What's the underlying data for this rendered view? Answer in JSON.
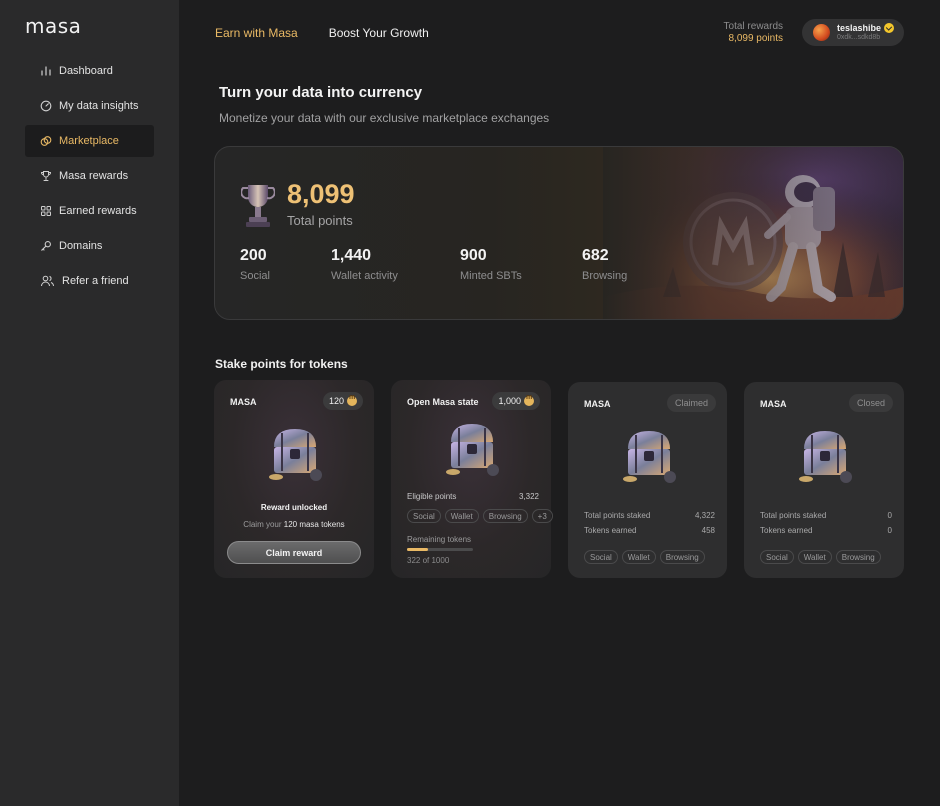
{
  "app": {
    "logo": "masa"
  },
  "sidebar": {
    "items": [
      {
        "label": "Dashboard",
        "icon": "bar-chart-icon"
      },
      {
        "label": "My data insights",
        "icon": "gauge-icon"
      },
      {
        "label": "Marketplace",
        "icon": "coins-icon",
        "active": true
      },
      {
        "label": "Masa rewards",
        "icon": "trophy-icon"
      },
      {
        "label": "Earned rewards",
        "icon": "grid-icon"
      },
      {
        "label": "Domains",
        "icon": "key-icon"
      },
      {
        "label": "Refer a friend",
        "icon": "users-icon"
      }
    ]
  },
  "topbar": {
    "tabs": [
      {
        "label": "Earn with Masa",
        "active": true
      },
      {
        "label": "Boost Your Growth",
        "active": false
      }
    ],
    "total_rewards_label": "Total rewards",
    "total_rewards_value": "8,099 points",
    "user": {
      "name": "teslashibe",
      "address": "0xdk...sdkd8b"
    }
  },
  "hero": {
    "title": "Turn your data into currency",
    "subtitle": "Monetize your data with our exclusive marketplace exchanges",
    "total_points": "8,099",
    "total_points_label": "Total points",
    "stats": [
      {
        "value": "200",
        "label": "Social"
      },
      {
        "value": "1,440",
        "label": "Wallet activity"
      },
      {
        "value": "900",
        "label": "Minted SBTs"
      },
      {
        "value": "682",
        "label": "Browsing"
      }
    ]
  },
  "stake": {
    "title": "Stake points for tokens",
    "cards": [
      {
        "name": "MASA",
        "badge": "120",
        "unlocked_title": "Reward unlocked",
        "claim_prefix": "Claim your ",
        "claim_amount": "120 masa tokens",
        "button": "Claim reward"
      },
      {
        "name": "Open Masa state",
        "badge": "1,000",
        "eligible_label": "Eligible points",
        "eligible_value": "3,322",
        "tags": [
          "Social",
          "Wallet",
          "Browsing",
          "+3"
        ],
        "remaining_label": "Remaining tokens",
        "remaining_value": "322 of 1000",
        "remaining_fraction": 0.322
      },
      {
        "name": "MASA",
        "status": "Claimed",
        "staked_label": "Total points staked",
        "staked_value": "4,322",
        "earned_label": "Tokens earned",
        "earned_value": "458",
        "tags": [
          "Social",
          "Wallet",
          "Browsing"
        ]
      },
      {
        "name": "MASA",
        "status": "Closed",
        "staked_label": "Total points staked",
        "staked_value": "0",
        "earned_label": "Tokens earned",
        "earned_value": "0",
        "tags": [
          "Social",
          "Wallet",
          "Browsing"
        ]
      }
    ]
  },
  "colors": {
    "accent": "#e9b965",
    "background": "#1d1d1e",
    "sidebar": "#2a2a2b"
  }
}
